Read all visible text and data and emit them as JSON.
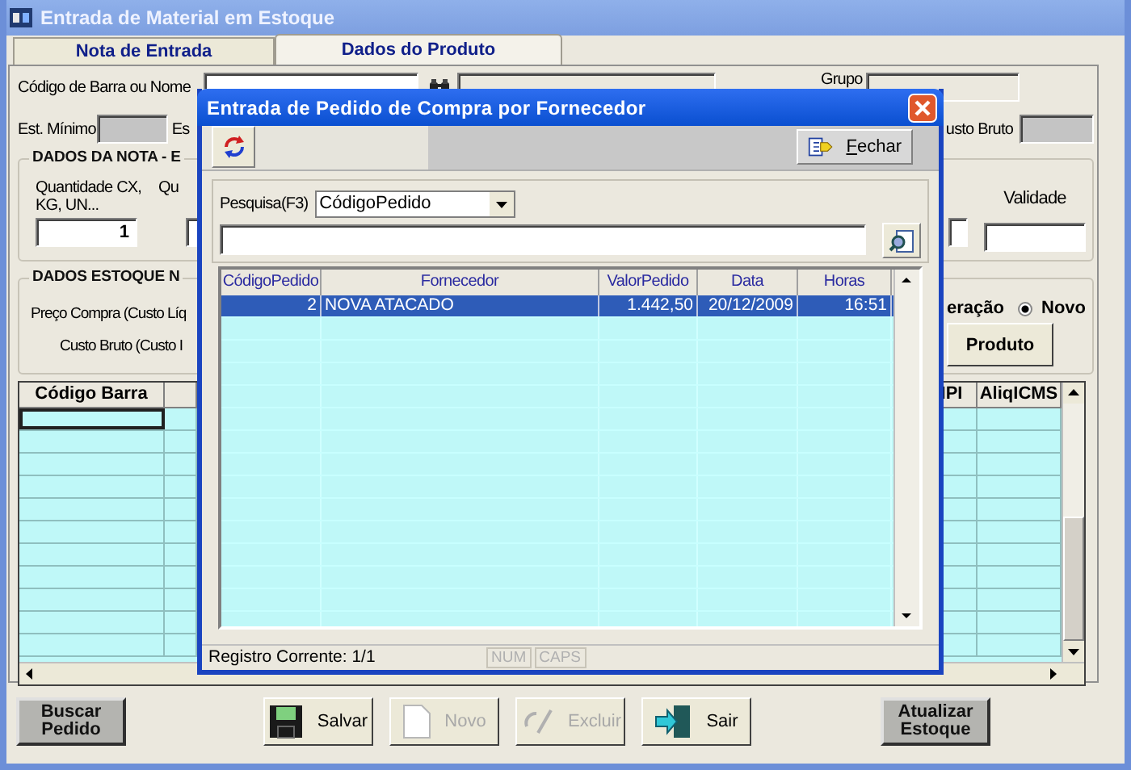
{
  "window": {
    "title": "Entrada de Material em Estoque"
  },
  "tabs": [
    {
      "label": "Nota de Entrada",
      "selected": false
    },
    {
      "label": "Dados do Produto",
      "selected": true
    }
  ],
  "product": {
    "barcode_label": "Código de Barra ou Nome",
    "group_label": "Grupo",
    "min_stock_label": "Est. Mínimo",
    "cut_label": "Es",
    "gross_cost_label": "usto Bruto"
  },
  "invoice_group": {
    "legend": "DADOS DA NOTA - E",
    "quantity_label": "Quantidade CX, KG, UN...",
    "quantity_value": "1",
    "cut_label": "Qu",
    "validity_label": "Validade"
  },
  "stock_group": {
    "legend": "DADOS ESTOQUE N",
    "purchase_price_label": "Preço Compra (Custo Líq",
    "gross_cost_label": "Custo Bruto (Custo I",
    "operation_label": "eração",
    "radio": {
      "label": "Novo",
      "selected": true
    },
    "product_button": "Produto"
  },
  "grid": {
    "columns": [
      "Código Barra",
      "IPI",
      "AliqICMS"
    ]
  },
  "left_button": "Buscar Pedido",
  "actions": [
    {
      "kind": "save",
      "label": "Salvar",
      "disabled": false
    },
    {
      "kind": "new",
      "label": "Novo",
      "disabled": true
    },
    {
      "kind": "delete",
      "label": "Excluir",
      "disabled": true
    },
    {
      "kind": "exit",
      "label": "Sair",
      "disabled": false
    }
  ],
  "right_button": "Atualizar Estoque",
  "dialog": {
    "title": "Entrada de Pedido de Compra por Fornecedor",
    "close_button": "Fechar",
    "search": {
      "label": "Pesquisa(F3)",
      "field": "CódigoPedido"
    },
    "table": {
      "columns": [
        "CódigoPedido",
        "Fornecedor",
        "ValorPedido",
        "Data",
        "Horas"
      ],
      "rows": [
        {
          "cells": [
            "2",
            "NOVA ATACADO",
            "1.442,50",
            "20/12/2009",
            "16:51"
          ],
          "selected": true
        }
      ]
    },
    "status_bar": {
      "text": "Registro Corrente: 1/1",
      "indicators": [
        {
          "label": "NUM",
          "on": false
        },
        {
          "label": "CAPS",
          "on": false
        }
      ]
    }
  }
}
